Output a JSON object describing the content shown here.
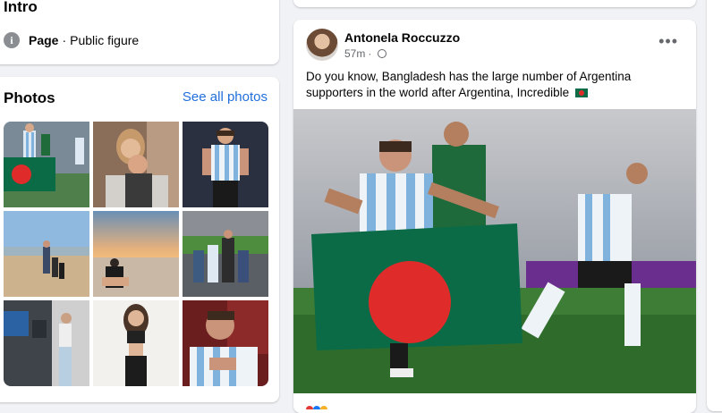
{
  "intro": {
    "title": "Intro",
    "page_label": "Page",
    "separator": "·",
    "category": "Public figure",
    "icon": "info-icon"
  },
  "photos": {
    "title": "Photos",
    "see_all": "See all photos",
    "items": [
      {
        "name": "photo-messi-bangladesh-flag"
      },
      {
        "name": "photo-couple-selfie"
      },
      {
        "name": "photo-messi-standing"
      },
      {
        "name": "photo-beach-family"
      },
      {
        "name": "photo-sunset-beach"
      },
      {
        "name": "photo-family-stadium"
      },
      {
        "name": "photo-mirror-selfie"
      },
      {
        "name": "photo-woman-white-wall"
      },
      {
        "name": "photo-messi-hand-chest"
      }
    ]
  },
  "post": {
    "author": "Antonela Roccuzzo",
    "time": "57m",
    "dot": "·",
    "text": "Do you know, Bangladesh has the large number of Argentina supporters in the world after Argentina, Incredible",
    "more_icon": "more-options-icon",
    "colors": {
      "flag_green": "#0a6b46",
      "flag_red": "#e02b2b",
      "link_blue": "#216fdb"
    }
  }
}
